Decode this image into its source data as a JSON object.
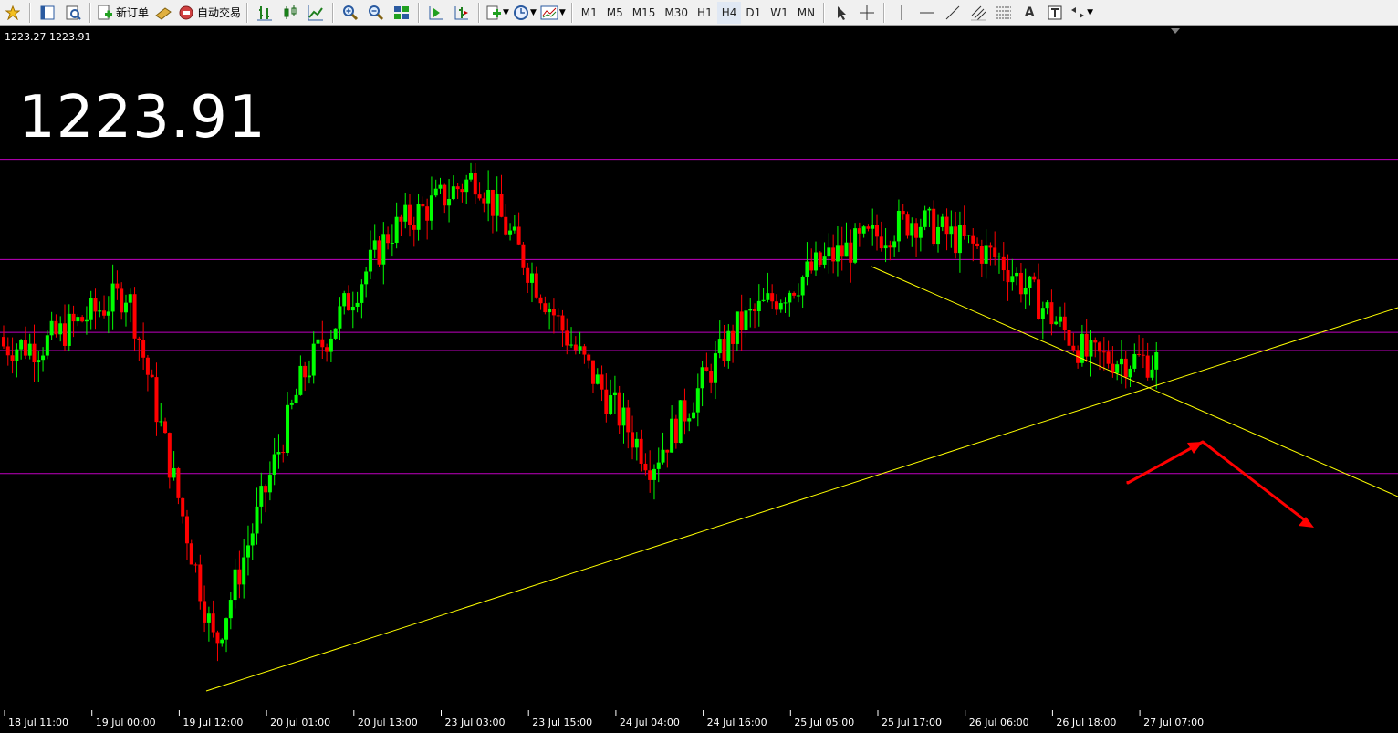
{
  "toolbar": {
    "new_order_label": "新订单",
    "auto_trading_label": "自动交易",
    "timeframes": [
      "M1",
      "M5",
      "M15",
      "M30",
      "H1",
      "H4",
      "D1",
      "W1",
      "MN"
    ],
    "active_timeframe": "H4",
    "text_tool_label": "A"
  },
  "chart": {
    "quote_line": "1223.27 1223.91",
    "big_price": "1223.91",
    "x_ticks": [
      "18 Jul 11:00",
      "19 Jul 00:00",
      "19 Jul 12:00",
      "20 Jul 01:00",
      "20 Jul 13:00",
      "23 Jul 03:00",
      "23 Jul 15:00",
      "24 Jul 04:00",
      "24 Jul 16:00",
      "25 Jul 05:00",
      "25 Jul 17:00",
      "26 Jul 06:00",
      "26 Jul 18:00",
      "27 Jul 07:00"
    ],
    "colors": {
      "background": "#000000",
      "bull_candle": "#00ff00",
      "bear_candle": "#ff0000",
      "horizontal_level": "#c000c0",
      "trendline": "#ffff00",
      "arrow": "#ff0000"
    }
  },
  "chart_data": {
    "type": "candlestick",
    "title": "",
    "xlabel": "",
    "ylabel": "",
    "ylim": [
      1210,
      1240
    ],
    "last_price": 1223.91,
    "horizontal_levels": [
      1234.2,
      1229.8,
      1226.6,
      1225.8,
      1220.4
    ],
    "x": [
      "18 Jul 11:00",
      "19 Jul 00:00",
      "19 Jul 12:00",
      "20 Jul 01:00",
      "20 Jul 13:00",
      "23 Jul 03:00",
      "23 Jul 15:00",
      "24 Jul 04:00",
      "24 Jul 16:00",
      "25 Jul 05:00",
      "25 Jul 17:00",
      "26 Jul 06:00",
      "26 Jul 18:00",
      "27 Jul 07:00"
    ],
    "series": [
      {
        "values": [
          1226.0,
          1228.4,
          1212.8,
          1224.6,
          1231.0,
          1233.5,
          1226.6,
          1220.8,
          1226.9,
          1229.8,
          1231.6,
          1229.8,
          1225.5,
          1225.3
        ]
      }
    ],
    "grid": false,
    "legend": "none"
  }
}
